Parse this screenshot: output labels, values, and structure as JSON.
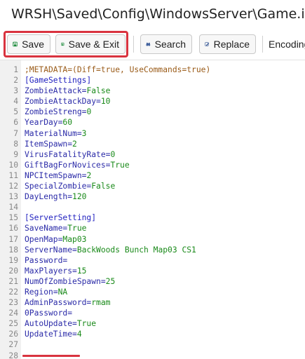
{
  "window": {
    "title": "WRSH\\Saved\\Config\\WindowsServer\\Game.ini"
  },
  "toolbar": {
    "save_label": "Save",
    "save_exit_label": "Save & Exit",
    "search_label": "Search",
    "replace_label": "Replace",
    "encoding_label": "Encoding"
  },
  "colors": {
    "highlight": "#d9333f",
    "key": "#2b2ba8",
    "value": "#1a8a1a",
    "comment": "#9a5b18"
  },
  "editor": {
    "lines": [
      {
        "num": "1",
        "type": "comment",
        "text": ";METADATA=(Diff=true, UseCommands=true)"
      },
      {
        "num": "2",
        "type": "section",
        "text": "[GameSettings]"
      },
      {
        "num": "3",
        "type": "kv",
        "key": "ZombieAttack",
        "value": "False"
      },
      {
        "num": "4",
        "type": "kv",
        "key": "ZombieAttackDay",
        "value": "10"
      },
      {
        "num": "5",
        "type": "kv",
        "key": "ZombieStreng",
        "value": "0"
      },
      {
        "num": "6",
        "type": "kv",
        "key": "YearDay",
        "value": "60"
      },
      {
        "num": "7",
        "type": "kv",
        "key": "MaterialNum",
        "value": "3"
      },
      {
        "num": "8",
        "type": "kv",
        "key": "ItemSpawn",
        "value": "2"
      },
      {
        "num": "9",
        "type": "kv",
        "key": "VirusFatalityRate",
        "value": "0"
      },
      {
        "num": "10",
        "type": "kv",
        "key": "GiftBagForNovices",
        "value": "True"
      },
      {
        "num": "11",
        "type": "kv",
        "key": "NPCItemSpawn",
        "value": "2"
      },
      {
        "num": "12",
        "type": "kv",
        "key": "SpecialZombie",
        "value": "False"
      },
      {
        "num": "13",
        "type": "kv",
        "key": "DayLength",
        "value": "120"
      },
      {
        "num": "14",
        "type": "blank",
        "text": ""
      },
      {
        "num": "15",
        "type": "section",
        "text": "[ServerSetting]"
      },
      {
        "num": "16",
        "type": "kv",
        "key": "SaveName",
        "value": "True"
      },
      {
        "num": "17",
        "type": "kv",
        "key": "OpenMap",
        "value": "Map03"
      },
      {
        "num": "18",
        "type": "kv",
        "key": "ServerName",
        "value": "BackWoods Bunch Map03 CS1"
      },
      {
        "num": "19",
        "type": "kv",
        "key": "Password",
        "value": ""
      },
      {
        "num": "20",
        "type": "kv",
        "key": "MaxPlayers",
        "value": "15"
      },
      {
        "num": "21",
        "type": "kv",
        "key": "NumOfZombieSpawn",
        "value": "25"
      },
      {
        "num": "22",
        "type": "kv",
        "key": "Region",
        "value": "NA"
      },
      {
        "num": "23",
        "type": "kv",
        "key": "AdminPassword",
        "value": "rmam"
      },
      {
        "num": "24",
        "type": "kv",
        "key": "0Password",
        "value": ""
      },
      {
        "num": "25",
        "type": "kv",
        "key": "AutoUpdate",
        "value": "True"
      },
      {
        "num": "26",
        "type": "kv",
        "key": "UpdateTime",
        "value": "4"
      },
      {
        "num": "27",
        "type": "blank",
        "text": ""
      },
      {
        "num": "28",
        "type": "blank",
        "text": ""
      }
    ]
  }
}
